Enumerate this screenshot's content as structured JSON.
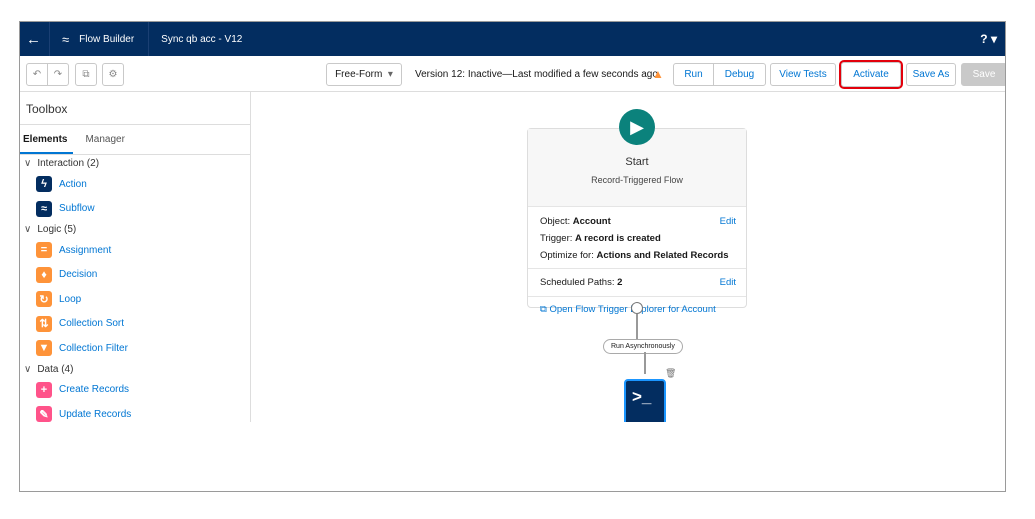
{
  "header": {
    "app_name": "Flow Builder",
    "flow_title": "Sync qb acc - V12",
    "help": "?"
  },
  "toolbar": {
    "mode": "Free-Form",
    "status": "Version 12: Inactive—Last modified a few seconds ago",
    "run": "Run",
    "debug": "Debug",
    "view_tests": "View Tests",
    "activate": "Activate",
    "save_as": "Save As",
    "save": "Save",
    "accent": "#0176d3",
    "highlight": "#e3000b"
  },
  "sidebar": {
    "title": "Toolbox",
    "tabs": [
      "Elements",
      "Manager"
    ],
    "sections": [
      {
        "label": "Interaction (2)",
        "items": [
          {
            "label": "Action",
            "icon": "lightning-icon",
            "color": "#032d60"
          },
          {
            "label": "Subflow",
            "icon": "flow-icon",
            "color": "#032d60"
          }
        ]
      },
      {
        "label": "Logic (5)",
        "items": [
          {
            "label": "Assignment",
            "icon": "equals-icon",
            "color": "#fe9339"
          },
          {
            "label": "Decision",
            "icon": "decision-icon",
            "color": "#fe9339"
          },
          {
            "label": "Loop",
            "icon": "loop-icon",
            "color": "#fe9339"
          },
          {
            "label": "Collection Sort",
            "icon": "sort-icon",
            "color": "#fe9339"
          },
          {
            "label": "Collection Filter",
            "icon": "filter-icon",
            "color": "#fe9339"
          }
        ]
      },
      {
        "label": "Data (4)",
        "items": [
          {
            "label": "Create Records",
            "icon": "create-record-icon",
            "color": "#ff538a"
          },
          {
            "label": "Update Records",
            "icon": "update-record-icon",
            "color": "#ff538a"
          }
        ]
      }
    ]
  },
  "canvas": {
    "start": {
      "title": "Start",
      "subtitle": "Record-Triggered Flow",
      "object_label": "Object:",
      "object": "Account",
      "trigger_label": "Trigger:",
      "trigger": "A record is created",
      "optimize_label": "Optimize for:",
      "optimize": "Actions and Related Records",
      "edit": "Edit",
      "scheduled_label": "Scheduled Paths:",
      "scheduled": "2",
      "explorer_link": "Open Flow Trigger Explorer for Account"
    },
    "path_label": "Run Asynchronously"
  }
}
